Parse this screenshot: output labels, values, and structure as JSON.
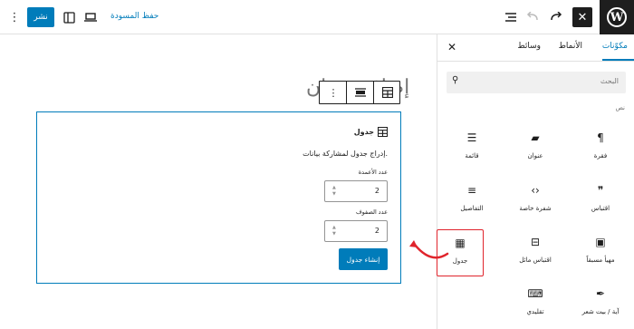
{
  "topbar": {
    "publish_label": "نشر",
    "save_draft_label": "حفظ المسودة",
    "more_icon": "vertical-ellipsis-icon",
    "sidebar_icon": "sidebar-toggle-icon",
    "preview_icon": "desktop-preview-icon",
    "list_view_icon": "list-view-icon",
    "undo_icon": "undo-icon",
    "redo_icon": "redo-icon",
    "close_inserter_icon": "close-icon",
    "logo": "W"
  },
  "inserter": {
    "tabs": [
      {
        "label": "مكوّنات",
        "active": true
      },
      {
        "label": "الأنماط",
        "active": false
      },
      {
        "label": "وسائط",
        "active": false
      }
    ],
    "search_placeholder": "البحث",
    "category_label": "نص",
    "blocks": [
      {
        "label": "فقرة",
        "icon": "¶"
      },
      {
        "label": "عنوان",
        "icon": "▰"
      },
      {
        "label": "قائمة",
        "icon": "☰"
      },
      {
        "label": "اقتباس",
        "icon": "❞"
      },
      {
        "label": "شفرة خاصة",
        "icon": "‹›"
      },
      {
        "label": "التفاصيل",
        "icon": "≡"
      },
      {
        "label": "مهيأ مسبقاً",
        "icon": "▣"
      },
      {
        "label": "اقتباس مائل",
        "icon": "⊟"
      },
      {
        "label": "جدول",
        "icon": "▦"
      },
      {
        "label": "آية / بيت شعر",
        "icon": "✒"
      },
      {
        "label": "تقليدي",
        "icon": "⌨"
      }
    ],
    "accent_color": "#007cba",
    "highlight_color": "#e0242c"
  },
  "canvas": {
    "title_placeholder": "إضافة عنوان",
    "block_toolbar": {
      "table_icon": "table-icon",
      "align_icon": "align-icon",
      "more_icon": "vertical-ellipsis-icon"
    },
    "table_placeholder": {
      "title": "جدول",
      "instructions": "إدراج جدول لمشاركة بيانات.",
      "columns_label": "عدد الأعمدة",
      "columns_value": "2",
      "rows_label": "عدد الصفوف",
      "rows_value": "2",
      "create_label": "إنشاء جدول"
    }
  }
}
